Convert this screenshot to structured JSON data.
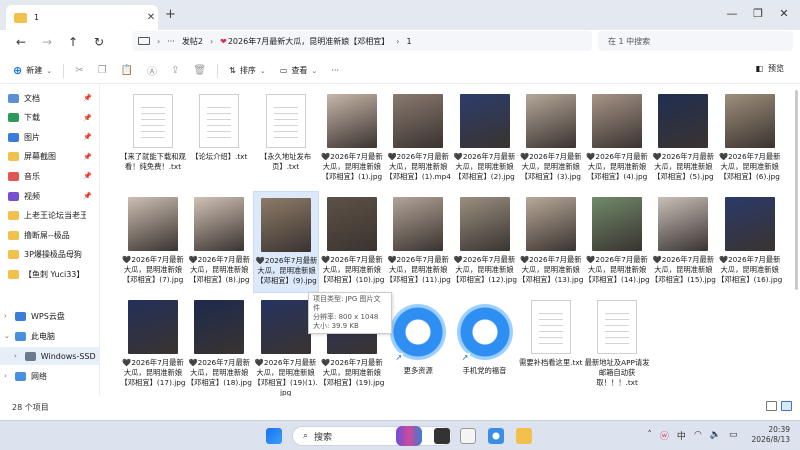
{
  "window": {
    "tab_title": "1",
    "new_tab": "+"
  },
  "nav": {
    "breadcrumb": [
      "发帖2",
      "2026年7月最新大瓜，昆明准新娘【邓相宜】",
      "1"
    ],
    "ellipsis": "···",
    "search_placeholder": "在 1 中搜索"
  },
  "toolbar": {
    "new": "新建",
    "sort": "排序",
    "view": "查看",
    "more": "···",
    "preview": "预览"
  },
  "sidebar": {
    "items": [
      {
        "label": "文档",
        "pinned": true,
        "color": "#5b8fd6"
      },
      {
        "label": "下载",
        "pinned": true,
        "color": "#2e9a5a"
      },
      {
        "label": "图片",
        "pinned": true,
        "color": "#3b7dd8"
      },
      {
        "label": "屏幕截图",
        "pinned": true,
        "color": "#f2c14b"
      },
      {
        "label": "音乐",
        "pinned": true,
        "color": "#e1544f"
      },
      {
        "label": "视频",
        "pinned": true,
        "color": "#7a4fcf"
      },
      {
        "label": "上老王论坛当老王",
        "pinned": false,
        "color": "#f2c14b"
      },
      {
        "label": "撸断屌--极品",
        "pinned": false,
        "color": "#f2c14b"
      },
      {
        "label": "3P爆操极品母狗",
        "pinned": false,
        "color": "#f2c14b"
      },
      {
        "label": "【鱼刺 Yuci33】",
        "pinned": false,
        "color": "#f2c14b"
      }
    ],
    "tree": [
      {
        "label": "WPS云盘",
        "color": "#3b7dd8"
      },
      {
        "label": "此电脑",
        "color": "#4a8fe0"
      },
      {
        "label": "Windows-SSD",
        "color": "#6b7a8c"
      },
      {
        "label": "网络",
        "color": "#4a8fe0"
      }
    ]
  },
  "files": [
    {
      "name": "【来了就能下载和观看！纯免费！.txt",
      "kind": "txt"
    },
    {
      "name": "【论坛介绍】.txt",
      "kind": "txt"
    },
    {
      "name": "【永久地址发布页】.txt",
      "kind": "txt"
    },
    {
      "name": "🖤2026年7月最新大瓜，昆明准新娘【邓相宜】(1).jpg",
      "kind": "img",
      "color": "#c8b7aa"
    },
    {
      "name": "🖤2026年7月最新大瓜，昆明准新娘【邓相宜】(1).mp4",
      "kind": "img",
      "color": "#8a7a70"
    },
    {
      "name": "🖤2026年7月最新大瓜，昆明准新娘【邓相宜】(2).jpg",
      "kind": "img",
      "color": "#2b3d6b"
    },
    {
      "name": "🖤2026年7月最新大瓜，昆明准新娘【邓相宜】(3).jpg",
      "kind": "img",
      "color": "#b5a79a"
    },
    {
      "name": "🖤2026年7月最新大瓜，昆明准新娘【邓相宜】(4).jpg",
      "kind": "img",
      "color": "#a69487"
    },
    {
      "name": "🖤2026年7月最新大瓜，昆明准新娘【邓相宜】(5).jpg",
      "kind": "img",
      "color": "#1f2f52"
    },
    {
      "name": "🖤2026年7月最新大瓜，昆明准新娘【邓相宜】(6).jpg",
      "kind": "img",
      "color": "#9f8f7c"
    },
    {
      "name": "🖤2026年7月最新大瓜，昆明准新娘【邓相宜】(7).jpg",
      "kind": "img",
      "color": "#cdbfb2"
    },
    {
      "name": "🖤2026年7月最新大瓜，昆明准新娘【邓相宜】(8).jpg",
      "kind": "img",
      "color": "#d2c2b5"
    },
    {
      "name": "🖤2026年7月最新大瓜，昆明准新娘【邓相宜】(9).jpg",
      "kind": "img",
      "color": "#8d7b68",
      "hover": true
    },
    {
      "name": "🖤2026年7月最新大瓜，昆明准新娘【邓相宜】(10).jpg",
      "kind": "img",
      "color": "#5e5247"
    },
    {
      "name": "🖤2026年7月最新大瓜，昆明准新娘【邓相宜】(11).jpg",
      "kind": "img",
      "color": "#b3a497"
    },
    {
      "name": "🖤2026年7月最新大瓜，昆明准新娘【邓相宜】(12).jpg",
      "kind": "img",
      "color": "#9a9080"
    },
    {
      "name": "🖤2026年7月最新大瓜，昆明准新娘【邓相宜】(13).jpg",
      "kind": "img",
      "color": "#b8a999"
    },
    {
      "name": "🖤2026年7月最新大瓜，昆明准新娘【邓相宜】(14).jpg",
      "kind": "img",
      "color": "#6f8a6a"
    },
    {
      "name": "🖤2026年7月最新大瓜，昆明准新娘【邓相宜】(15).jpg",
      "kind": "img",
      "color": "#c8c0b8"
    },
    {
      "name": "🖤2026年7月最新大瓜，昆明准新娘【邓相宜】(16).jpg",
      "kind": "img",
      "color": "#2a3a6a"
    },
    {
      "name": "🖤2026年7月最新大瓜，昆明准新娘【邓相宜】(17).jpg",
      "kind": "img",
      "color": "#22305a"
    },
    {
      "name": "🖤2026年7月最新大瓜，昆明准新娘【邓相宜】(18).jpg",
      "kind": "img",
      "color": "#1c2a4e"
    },
    {
      "name": "🖤2026年7月最新大瓜，昆明准新娘【邓相宜】(19)(1).jpg",
      "kind": "img",
      "color": "#253360"
    },
    {
      "name": "🖤2026年7月最新大瓜，昆明准新娘【邓相宜】(19).jpg",
      "kind": "img",
      "color": "#263462"
    },
    {
      "name": "更多资源",
      "kind": "app"
    },
    {
      "name": "手机党的福音",
      "kind": "app"
    },
    {
      "name": "需要补档看这里.txt",
      "kind": "txt"
    },
    {
      "name": "最新地址及APP请发邮箱自动获取！！！.txt",
      "kind": "txt"
    }
  ],
  "tooltip": {
    "type": "项目类型: JPG 图片文件",
    "dims": "分辨率: 800 x 1048",
    "size": "大小: 39.9 KB"
  },
  "status": {
    "count": "28 个项目"
  },
  "taskbar": {
    "search": "搜索",
    "time": "20:39",
    "date": "2026/8/13",
    "lang": "中"
  }
}
